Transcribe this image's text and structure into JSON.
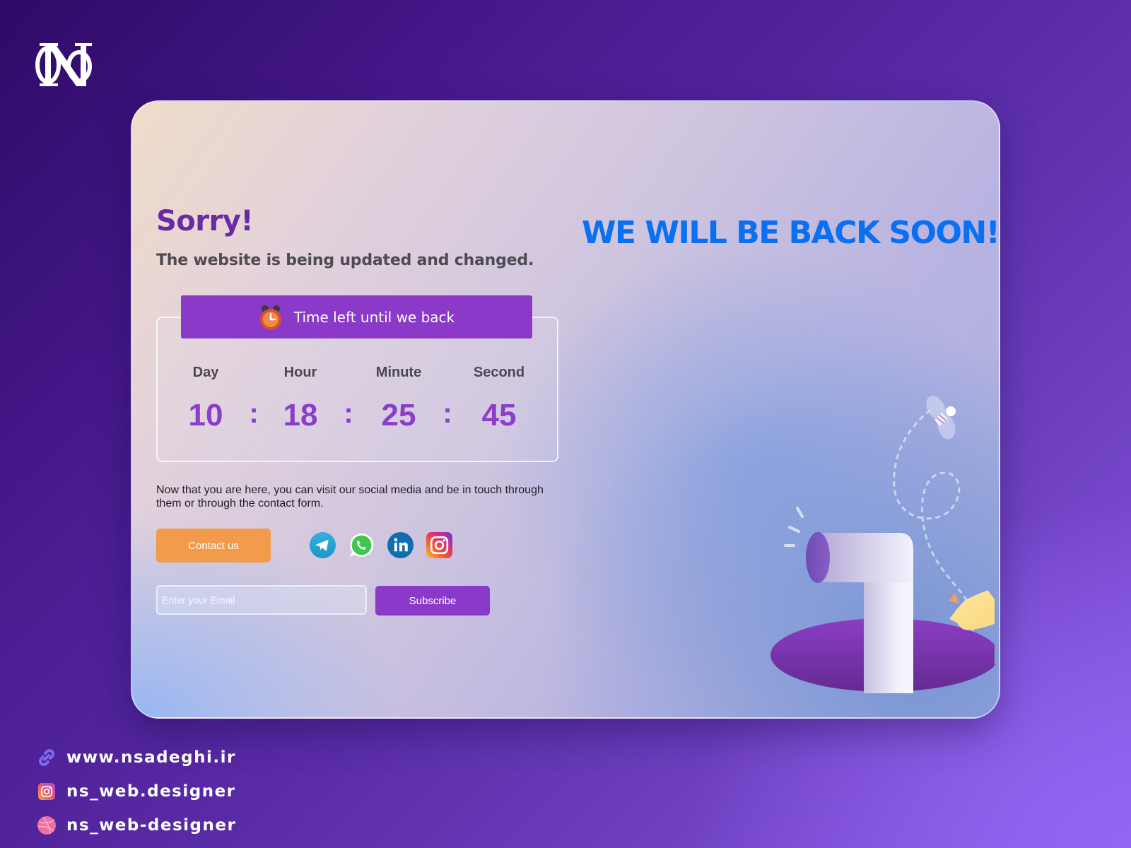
{
  "brand": {
    "logo_alt": "NS monogram logo"
  },
  "card": {
    "title": "Sorry!",
    "subtitle": "The website is being updated and changed.",
    "headline": "WE WILL BE BACK SOON!",
    "timer": {
      "banner_label": "Time left until we back",
      "icon": "alarm-clock-icon",
      "units": [
        {
          "label": "Day",
          "value": "10"
        },
        {
          "label": "Hour",
          "value": "18"
        },
        {
          "label": "Minute",
          "value": "25"
        },
        {
          "label": "Second",
          "value": "45"
        }
      ],
      "separator": ":"
    },
    "message": "Now that you are here, you can visit our social media and be in touch through them or through the contact form.",
    "contact_button": "Contact us",
    "socials": [
      {
        "name": "telegram",
        "icon": "telegram-icon"
      },
      {
        "name": "whatsapp",
        "icon": "whatsapp-icon"
      },
      {
        "name": "linkedin",
        "icon": "linkedin-icon"
      },
      {
        "name": "instagram",
        "icon": "instagram-icon"
      }
    ],
    "email": {
      "placeholder": "Enter your Email",
      "value": ""
    },
    "subscribe_button": "Subscribe"
  },
  "footer": {
    "items": [
      {
        "icon": "link-icon",
        "text": "www.nsadeghi.ir"
      },
      {
        "icon": "instagram-icon",
        "text": "ns_web.designer"
      },
      {
        "icon": "dribbble-icon",
        "text": "ns_web-designer"
      }
    ]
  },
  "colors": {
    "primary_purple": "#8a39c8",
    "title_purple": "#6a2aa3",
    "headline_blue": "#0a6ff0",
    "contact_orange": "#f29b4b",
    "countdown_value": "#8b3ec9"
  }
}
